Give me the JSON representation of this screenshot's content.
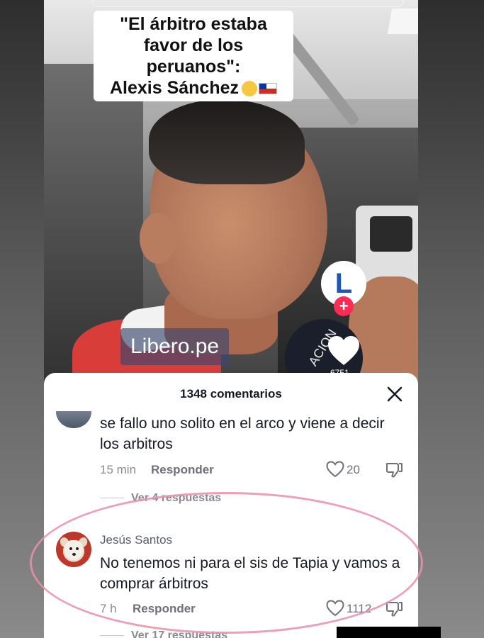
{
  "video": {
    "caption_line1": "\"El árbitro estaba",
    "caption_line2": "favor de los peruanos\":",
    "caption_line3": "Alexis Sánchez",
    "watermark": "Libero.pe",
    "mic_label": "ACION",
    "profile_initial": "L",
    "follow_symbol": "+",
    "like_count": "6751"
  },
  "comments_sheet": {
    "title": "1348 comentarios",
    "comments": [
      {
        "text": "se fallo uno solito en el arco y viene a decir los arbitros",
        "time": "15 min",
        "reply_label": "Responder",
        "likes": "20",
        "view_replies": "Ver 4 respuestas"
      },
      {
        "username": "Jesús Santos",
        "text": "No tenemos ni para el sis de Tapia y vamos a comprar árbitros",
        "time": "7 h",
        "reply_label": "Responder",
        "likes": "1112",
        "view_replies": "Ver 17 respuestas"
      }
    ]
  },
  "colors": {
    "accent_pink": "#fe2c55",
    "brand_blue": "#1e56b7",
    "highlight_ring": "#e890a8"
  },
  "icons": [
    "close-icon",
    "heart-icon",
    "dislike-icon",
    "follow-plus-icon"
  ]
}
